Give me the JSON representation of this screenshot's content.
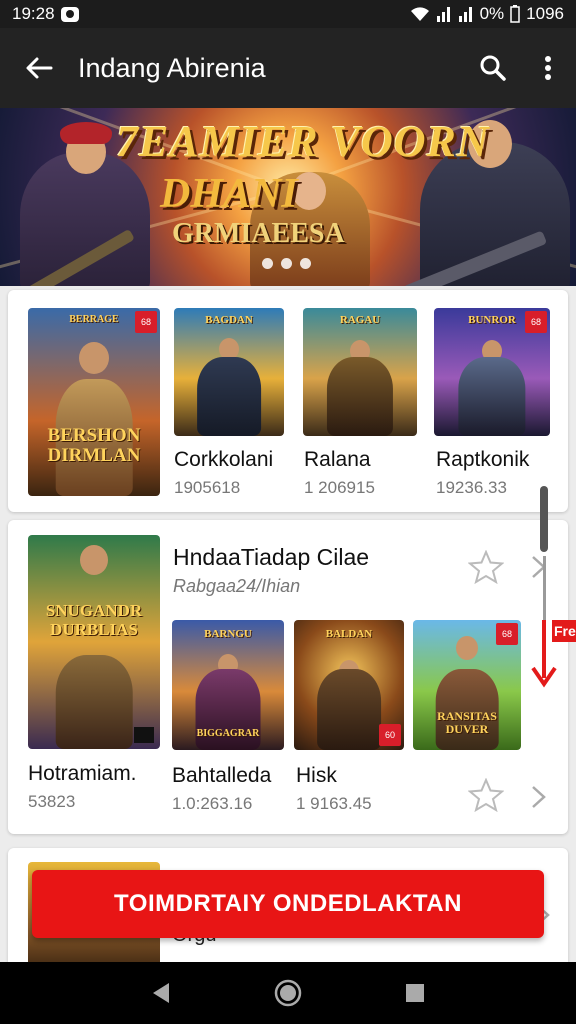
{
  "status_bar": {
    "time": "19:28",
    "battery": "0%",
    "clock_right": "1096"
  },
  "app_bar": {
    "title": "Indang Abirenia"
  },
  "banner": {
    "line1": "7EAMIER VOORN",
    "line2": "DHANI",
    "line3": "GRMIAEESA",
    "slide_count": 3
  },
  "section1": {
    "games": [
      {
        "name": "",
        "meta": "",
        "logo_top": "BERRAGE",
        "logo_bottom": "BERSHON DIRMLAN",
        "badge": "68"
      },
      {
        "name": "Corkkolani",
        "meta": "1905618",
        "logo_top": "BAGDAN"
      },
      {
        "name": "Ralana",
        "meta": "1 206915",
        "logo_top": "RAGAU"
      },
      {
        "name": "Raptkonik",
        "meta": "19236.33",
        "logo_top": "BUNROR",
        "badge": "68"
      }
    ]
  },
  "section2": {
    "title": "HndaaTiadap Cilae",
    "subtitle": "Rabgaa24/Ihian",
    "featured": {
      "name": "Hotramiam.",
      "meta": "53823",
      "logo": "SNUGANDR DURBLIAS"
    },
    "games": [
      {
        "name": "Bahtalleda",
        "meta": "1.0:263.16",
        "logo_top": "BARNGU",
        "logo_bottom": "BIGGAGRAR"
      },
      {
        "name": "Hisk",
        "meta": "1 9163.45",
        "logo_top": "BALDAN",
        "badge": "60"
      },
      {
        "name": "",
        "meta": "",
        "logo_bottom": "RANSITAS DUVER",
        "badge": "68"
      }
    ],
    "side_tag": "Fre"
  },
  "section3": {
    "partial_text": "Orgu"
  },
  "cta_button": {
    "label": "TOIMDRTAIY ONDEDLAKTAN"
  }
}
